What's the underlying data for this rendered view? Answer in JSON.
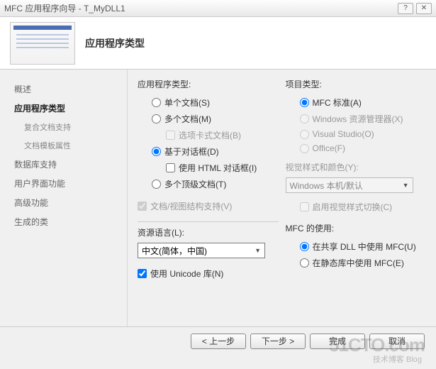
{
  "titlebar": {
    "title": "MFC 应用程序向导 - T_MyDLL1",
    "help": "?",
    "close": "✕"
  },
  "header": {
    "title": "应用程序类型"
  },
  "sidebar": {
    "items": [
      {
        "label": "概述"
      },
      {
        "label": "应用程序类型"
      },
      {
        "label": "复合文档支持"
      },
      {
        "label": "文档模板属性"
      },
      {
        "label": "数据库支持"
      },
      {
        "label": "用户界面功能"
      },
      {
        "label": "高级功能"
      },
      {
        "label": "生成的类"
      }
    ]
  },
  "left_col": {
    "section": "应用程序类型:",
    "opt_single": "单个文档(S)",
    "opt_multi": "多个文档(M)",
    "opt_tabbed": "选项卡式文档(B)",
    "opt_dialog": "基于对话框(D)",
    "opt_html": "使用 HTML 对话框(I)",
    "opt_toplevel": "多个顶级文档(T)",
    "opt_docview": "文档/视图结构支持(V)",
    "res_lang": "资源语言(L):",
    "lang_value": "中文(简体，中国)",
    "opt_unicode": "使用 Unicode 库(N)"
  },
  "right_col": {
    "proj_type": "项目类型:",
    "opt_mfc_std": "MFC 标准(A)",
    "opt_explorer": "Windows 资源管理器(X)",
    "opt_vs": "Visual Studio(O)",
    "opt_office": "Office(F)",
    "visual_style": "视觉样式和颜色(Y):",
    "style_value": "Windows 本机/默认",
    "opt_style_switch": "启用视觉样式切换(C)",
    "mfc_use": "MFC 的使用:",
    "opt_shared": "在共享 DLL 中使用 MFC(U)",
    "opt_static": "在静态库中使用 MFC(E)"
  },
  "footer": {
    "prev": "< 上一步",
    "next": "下一步 >",
    "finish": "完成",
    "cancel": "取消"
  },
  "watermark": {
    "main": "51CTO.com",
    "sub": "技术博客  Blog"
  }
}
